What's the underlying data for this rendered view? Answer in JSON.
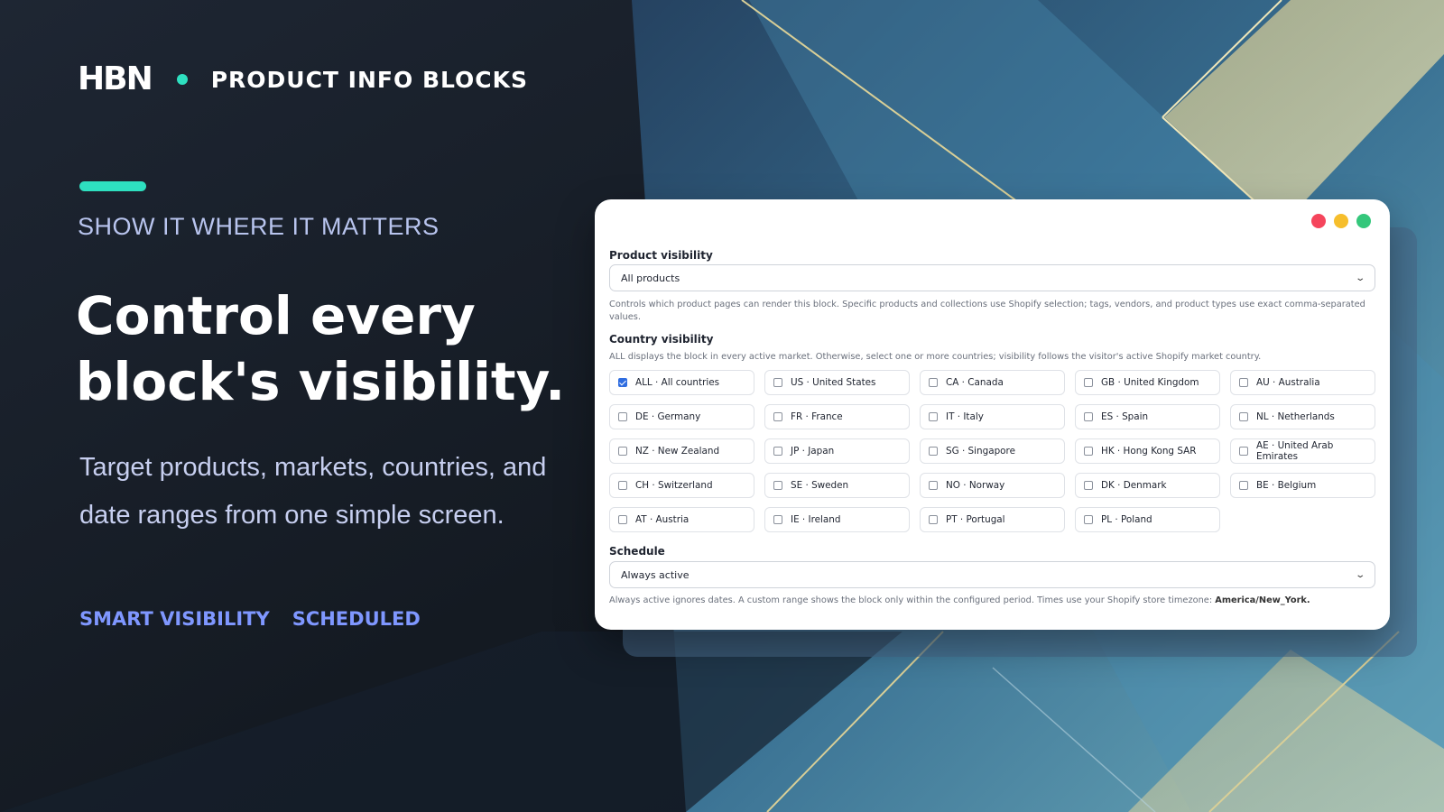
{
  "brand": {
    "logo": "HBN",
    "product_name": "PRODUCT INFO BLOCKS"
  },
  "hero": {
    "eyebrow": "SHOW IT WHERE IT MATTERS",
    "headline_line1": "Control every",
    "headline_line2": "block's visibility.",
    "subcopy": "Target products, markets, countries, and date ranges from one simple screen.",
    "tags": [
      "SMART VISIBILITY",
      "SCHEDULED"
    ]
  },
  "colors": {
    "accent": "#2ee0c0",
    "tag_text": "#7f97ff",
    "checkbox_checked": "#2f6de0",
    "window_buttons": [
      "#f5455c",
      "#f6be2c",
      "#34c77b"
    ]
  },
  "panel": {
    "product_visibility": {
      "label": "Product visibility",
      "selected": "All products",
      "help": "Controls which product pages can render this block. Specific products and collections use Shopify selection; tags, vendors, and product types use exact comma-separated values."
    },
    "country_visibility": {
      "label": "Country visibility",
      "help": "ALL displays the block in every active market. Otherwise, select one or more countries; visibility follows the visitor's active Shopify market country.",
      "options": [
        {
          "label": "ALL · All countries",
          "checked": true
        },
        {
          "label": "US · United States",
          "checked": false
        },
        {
          "label": "CA · Canada",
          "checked": false
        },
        {
          "label": "GB · United Kingdom",
          "checked": false
        },
        {
          "label": "AU · Australia",
          "checked": false
        },
        {
          "label": "DE · Germany",
          "checked": false
        },
        {
          "label": "FR · France",
          "checked": false
        },
        {
          "label": "IT · Italy",
          "checked": false
        },
        {
          "label": "ES · Spain",
          "checked": false
        },
        {
          "label": "NL · Netherlands",
          "checked": false
        },
        {
          "label": "NZ · New Zealand",
          "checked": false
        },
        {
          "label": "JP · Japan",
          "checked": false
        },
        {
          "label": "SG · Singapore",
          "checked": false
        },
        {
          "label": "HK · Hong Kong SAR",
          "checked": false
        },
        {
          "label": "AE · United Arab Emirates",
          "checked": false
        },
        {
          "label": "CH · Switzerland",
          "checked": false
        },
        {
          "label": "SE · Sweden",
          "checked": false
        },
        {
          "label": "NO · Norway",
          "checked": false
        },
        {
          "label": "DK · Denmark",
          "checked": false
        },
        {
          "label": "BE · Belgium",
          "checked": false
        },
        {
          "label": "AT · Austria",
          "checked": false
        },
        {
          "label": "IE · Ireland",
          "checked": false
        },
        {
          "label": "PT · Portugal",
          "checked": false
        },
        {
          "label": "PL · Poland",
          "checked": false
        }
      ]
    },
    "schedule": {
      "label": "Schedule",
      "selected": "Always active",
      "help": "Always active ignores dates. A custom range shows the block only within the configured period. Times use your Shopify store timezone:",
      "timezone": "America/New_York."
    }
  }
}
